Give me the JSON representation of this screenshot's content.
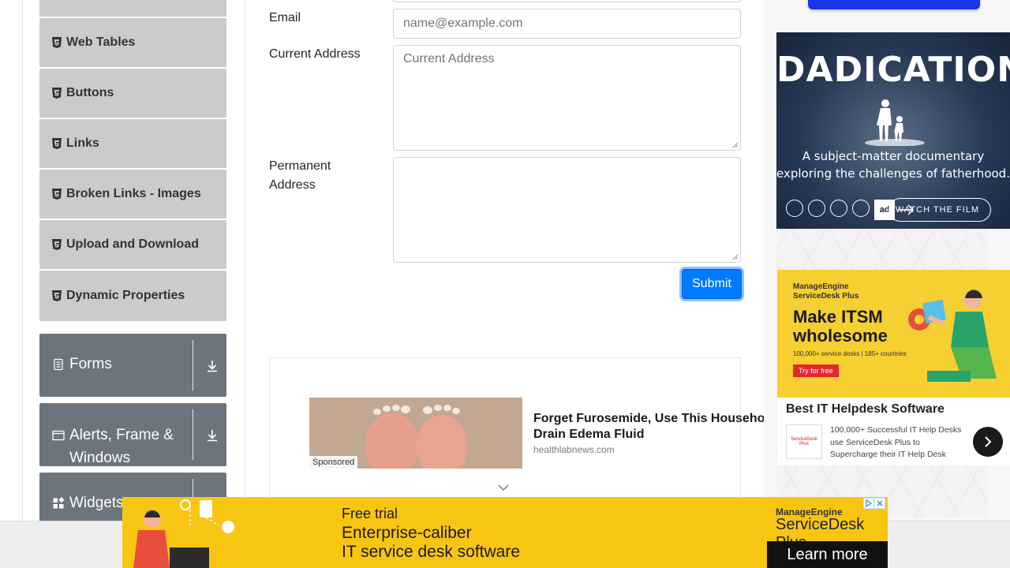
{
  "sidebar": {
    "items": [
      {
        "label": ""
      },
      {
        "label": "Web Tables"
      },
      {
        "label": "Buttons"
      },
      {
        "label": "Links"
      },
      {
        "label": "Broken Links - Images"
      },
      {
        "label": "Upload and Download"
      },
      {
        "label": "Dynamic Properties"
      }
    ],
    "groups": [
      {
        "label": "Forms"
      },
      {
        "label": "Alerts, Frame & Windows"
      },
      {
        "label": "Widgets"
      }
    ]
  },
  "form": {
    "email_label": "Email",
    "email_placeholder": "name@example.com",
    "current_address_label": "Current Address",
    "current_address_placeholder": "Current Address",
    "permanent_address_label": "Permanent Address",
    "submit_label": "Submit"
  },
  "sponsored": {
    "tag": "Sponsored",
    "title_line1": "Forget Furosemide, Use This Househo",
    "title_line2": "Drain Edema Fluid",
    "source": "healthlabnews.com"
  },
  "ads": {
    "dadication": {
      "title": "DADICATION",
      "subtitle_line1": "A subject-matter documentary",
      "subtitle_line2": "exploring the challenges of fatherhood.",
      "cta": "WATCH THE FILM",
      "logo_text": "ad"
    },
    "manageengine_side": {
      "brand_line1": "ManageEngine",
      "brand_line2": "ServiceDesk Plus",
      "headline_line1": "Make ITSM",
      "headline_line2": "wholesome",
      "small": "100,000+ service desks | 185+ countries",
      "cta": "Try for free",
      "title": "Best IT Helpdesk Software",
      "logo_text": "ServiceDesk Plus",
      "desc": "100,000+ Successful IT Help Desks use ServiceDesk Plus to Supercharge their IT Help Desk"
    },
    "banner": {
      "free": "Free trial",
      "line1": "Enterprise-caliber",
      "line2": "IT service desk software",
      "brand1": "ManageEngine",
      "brand2": "ServiceDesk Plus",
      "cta": "Learn more"
    }
  },
  "colors": {
    "primary": "#007bff",
    "sidebar_item": "#cbcbcb",
    "group_header": "#6c757d",
    "ad_yellow": "#f9c513"
  }
}
